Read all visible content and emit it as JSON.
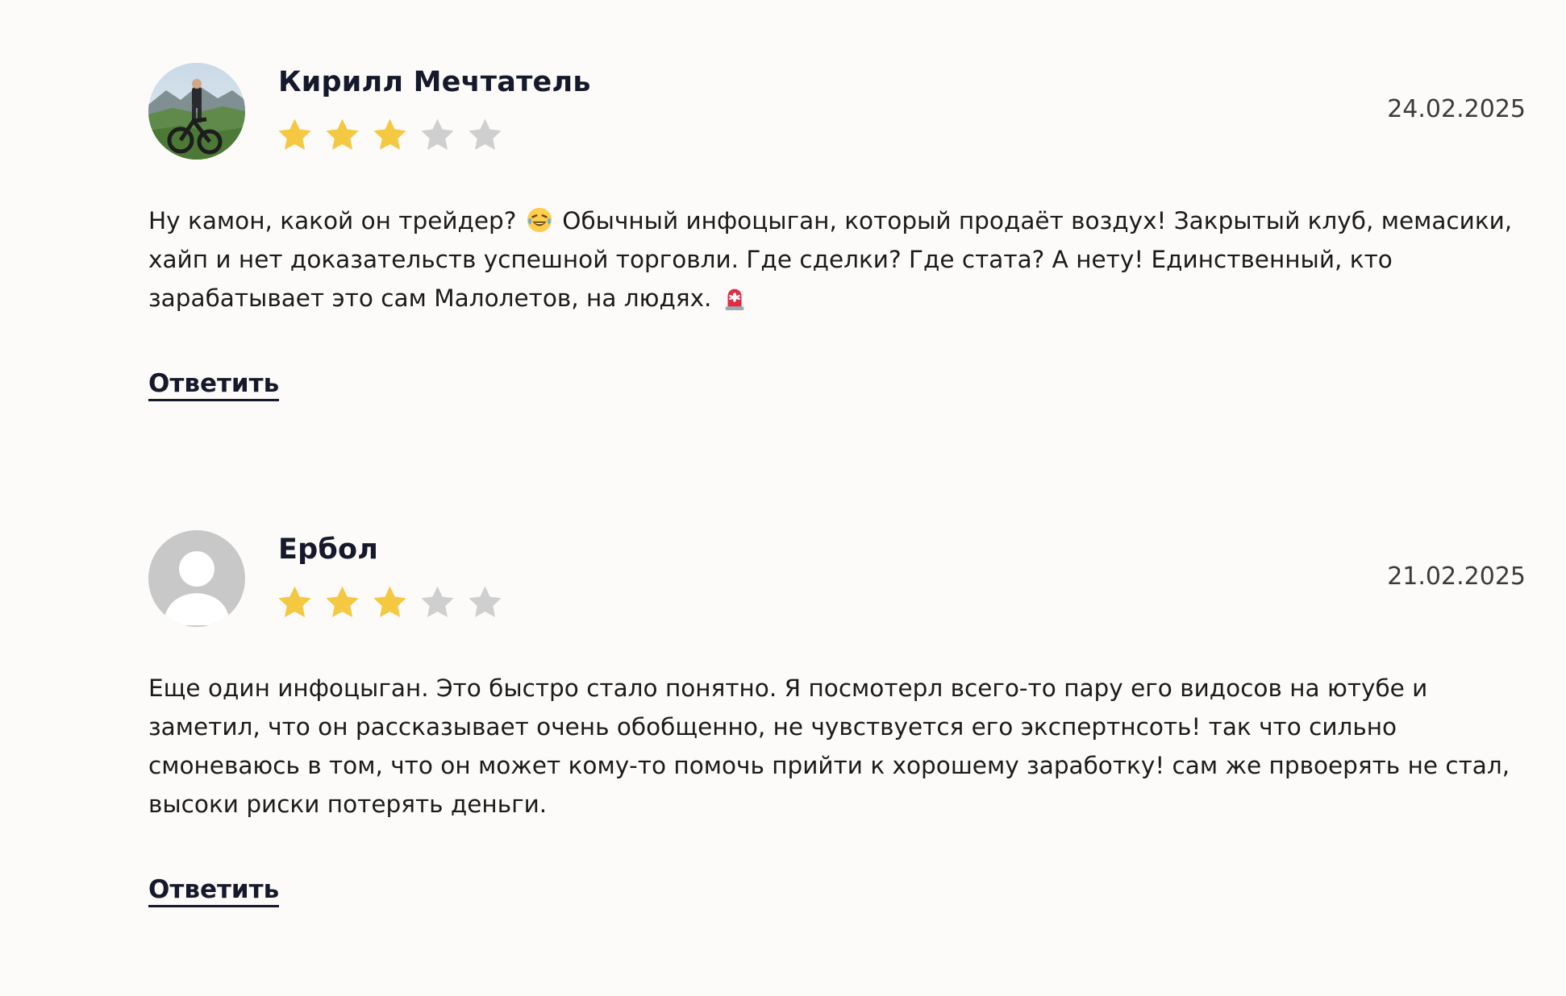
{
  "reviews": [
    {
      "author": "Кирилл Мечтатель",
      "date": "24.02.2025",
      "rating": 3,
      "rating_max": 5,
      "text_parts": [
        "Ну камон, какой он трейдер?",
        "Обычный инфоцыган, который продаёт воздух! Закрытый клуб, мемасики, хайп и нет доказательств успешной торговли. Где сделки? Где стата? А нету! Единственный, кто зарабатывает это сам Малолетов, на людях."
      ],
      "emojis": [
        "laughing-tears-emoji",
        "siren-emoji"
      ],
      "avatar": "photo-avatar",
      "reply_label": "Ответить"
    },
    {
      "author": "Ербол",
      "date": "21.02.2025",
      "rating": 3,
      "rating_max": 5,
      "text": "Еще один инфоцыган. Это быстро стало понятно. Я посмотерл всего-то пару его видосов на ютубе и заметил, что он рассказывает очень обобщенно, не чувствуется его экспертнсоть! так что сильно смоневаюсь в том, что он может кому-то помочь прийти к хорошему заработку! сам же првоерять не стал, высоки риски потерять деньги.",
      "avatar": "default-user-avatar",
      "reply_label": "Ответить"
    }
  ],
  "colors": {
    "background": "#fcfbf9",
    "star_filled": "#f5c842",
    "star_empty": "#cfcfcf",
    "author_text": "#15192b",
    "placeholder_avatar": "#c8c8c8"
  }
}
